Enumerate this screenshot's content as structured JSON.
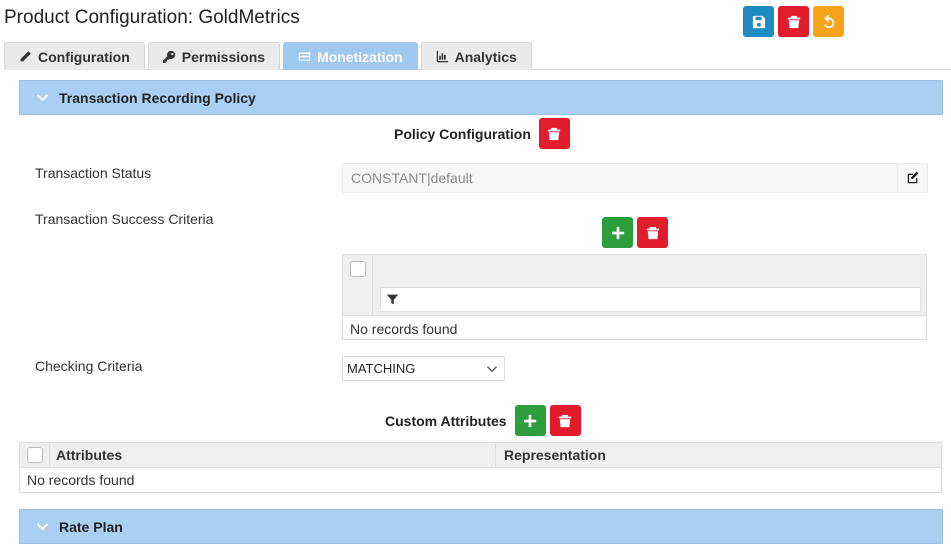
{
  "page": {
    "title": "Product Configuration: GoldMetrics"
  },
  "toolbar": {
    "save_icon": "save-icon",
    "delete_icon": "trash-icon",
    "revert_icon": "undo-icon"
  },
  "tabs": [
    {
      "label": "Configuration",
      "icon": "pencil-icon",
      "active": false
    },
    {
      "label": "Permissions",
      "icon": "key-icon",
      "active": false
    },
    {
      "label": "Monetization",
      "icon": "credit-card-icon",
      "active": true
    },
    {
      "label": "Analytics",
      "icon": "bar-chart-icon",
      "active": false
    }
  ],
  "policy_panel": {
    "title": "Transaction Recording Policy",
    "section_title": "Policy Configuration",
    "transaction_status": {
      "label": "Transaction Status",
      "value": "CONSTANT|default"
    },
    "success_criteria": {
      "label": "Transaction Success Criteria",
      "empty_text": "No records found",
      "filter_placeholder": ""
    },
    "checking_criteria": {
      "label": "Checking Criteria",
      "value": "MATCHING"
    },
    "custom_attributes": {
      "title": "Custom Attributes",
      "columns": [
        "Attributes",
        "Representation"
      ],
      "empty_text": "No records found"
    }
  },
  "rate_plan_panel": {
    "title": "Rate Plan"
  },
  "colors": {
    "primary": "#1e8bc3",
    "danger": "#e21c2c",
    "warning": "#f5a31a",
    "success": "#2e9e3c",
    "panel_header": "#a9d0f2",
    "active_tab": "#9fc9ee"
  }
}
